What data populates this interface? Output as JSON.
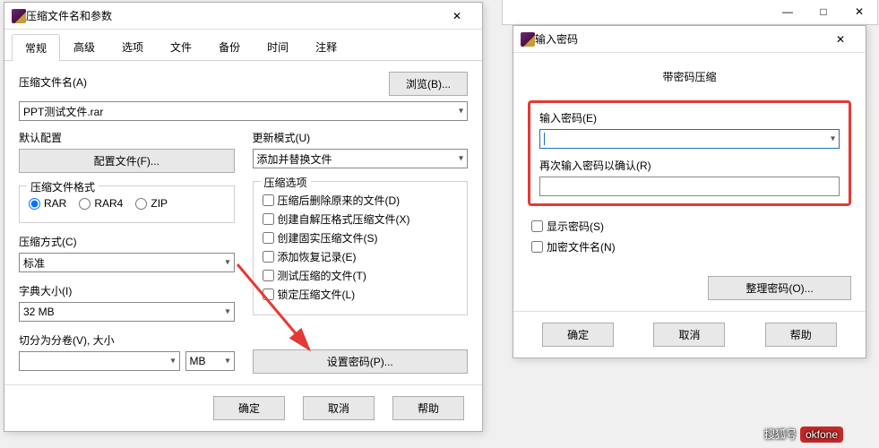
{
  "bg": {
    "min": "—",
    "max": "□",
    "close": "✕"
  },
  "main": {
    "title": "压缩文件名和参数",
    "tabs": [
      "常规",
      "高级",
      "选项",
      "文件",
      "备份",
      "时间",
      "注释"
    ],
    "archive_name_label": "压缩文件名(A)",
    "browse_btn": "浏览(B)...",
    "archive_name_value": "PPT测试文件.rar",
    "default_profile_label": "默认配置",
    "profiles_btn": "配置文件(F)...",
    "update_mode_label": "更新模式(U)",
    "update_mode_value": "添加并替换文件",
    "format_label": "压缩文件格式",
    "formats": [
      "RAR",
      "RAR4",
      "ZIP"
    ],
    "method_label": "压缩方式(C)",
    "method_value": "标准",
    "dict_label": "字典大小(I)",
    "dict_value": "32 MB",
    "split_label": "切分为分卷(V), 大小",
    "split_value": "",
    "split_unit": "MB",
    "options_label": "压缩选项",
    "options": [
      "压缩后删除原来的文件(D)",
      "创建自解压格式压缩文件(X)",
      "创建固实压缩文件(S)",
      "添加恢复记录(E)",
      "测试压缩的文件(T)",
      "锁定压缩文件(L)"
    ],
    "set_password_btn": "设置密码(P)...",
    "ok": "确定",
    "cancel": "取消",
    "help": "帮助"
  },
  "pwd": {
    "title": "输入密码",
    "subtitle": "带密码压缩",
    "enter_label": "输入密码(E)",
    "reenter_label": "再次输入密码以确认(R)",
    "show_pwd": "显示密码(S)",
    "encrypt_names": "加密文件名(N)",
    "organize_btn": "整理密码(O)...",
    "ok": "确定",
    "cancel": "取消",
    "help": "帮助"
  },
  "watermark": {
    "text": "搜狐号",
    "brand": "okfone"
  }
}
